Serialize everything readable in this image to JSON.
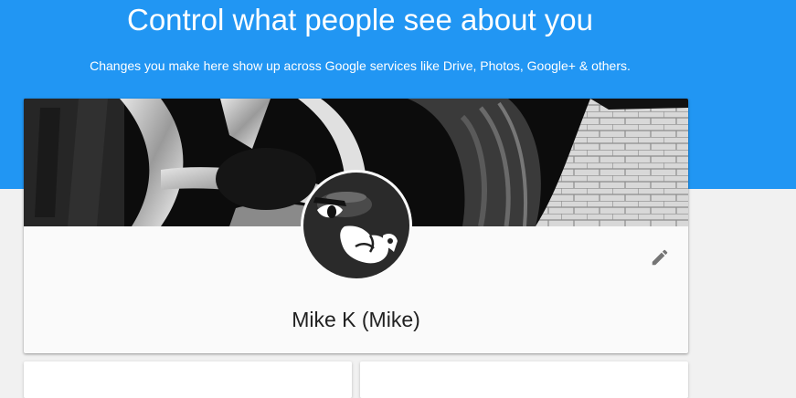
{
  "hero": {
    "title": "Control what people see about you",
    "subtitle": "Changes you make here show up across Google services like Drive, Photos, Google+ & others."
  },
  "profile": {
    "name": "Mike K (Mike)",
    "edit_icon": "pencil-icon",
    "avatar_icon": "bullet-bill-avatar"
  },
  "colors": {
    "hero_background": "#2196f3",
    "page_background": "#f1f1f1",
    "card_background": "#fafafa",
    "text_primary": "#212121",
    "icon_gray": "#757575"
  }
}
